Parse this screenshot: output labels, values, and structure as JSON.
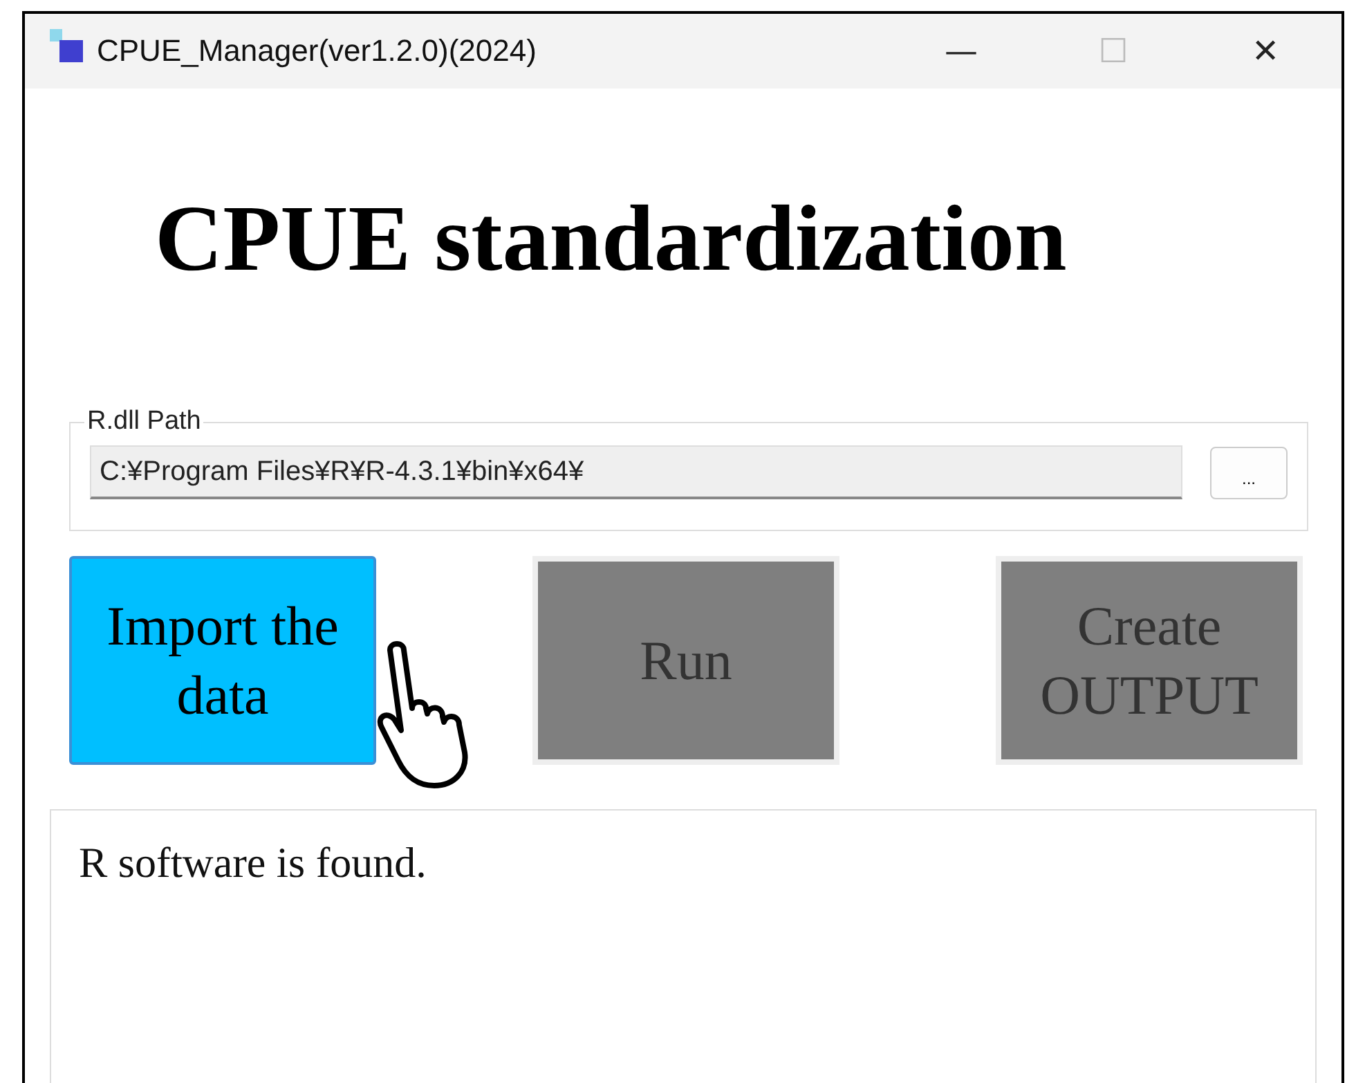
{
  "window": {
    "title": "CPUE_Manager(ver1.2.0)(2024)",
    "controls": [
      "—",
      "☐",
      "✕"
    ]
  },
  "heading": "CPUE standardization",
  "rdll_path": {
    "legend": "R.dll Path",
    "value": "C:¥Program Files¥R¥R-4.3.1¥bin¥x64¥",
    "browse_button": "..."
  },
  "actions": [
    {
      "label": "Import the data",
      "disabled": false
    },
    {
      "label": "Run",
      "disabled": true
    },
    {
      "label": "Create OUTPUT",
      "disabled": true
    }
  ],
  "log": "R software is found."
}
